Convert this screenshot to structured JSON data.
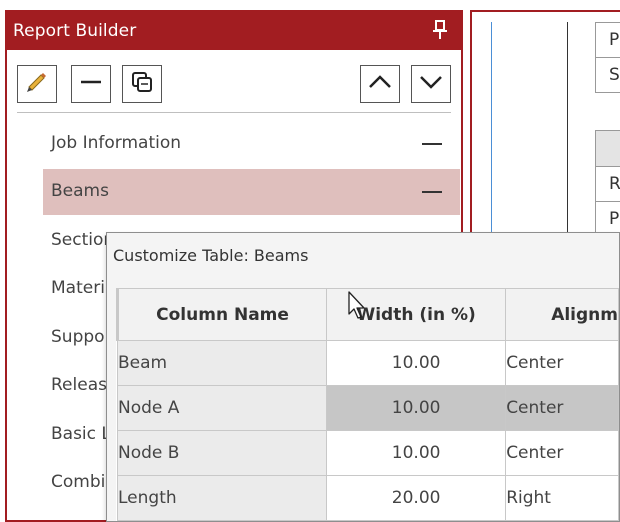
{
  "report_builder": {
    "title": "Report Builder",
    "toolbar": {
      "edit_icon": "pencil-icon",
      "collapse_icon": "minus-icon",
      "copy_icon": "copy-icon",
      "move_up_icon": "chevron-up-icon",
      "move_down_icon": "chevron-down-icon"
    },
    "items": [
      {
        "label": "Job Information"
      },
      {
        "label": "Beams"
      },
      {
        "label": "Section"
      },
      {
        "label": "Materi"
      },
      {
        "label": "Suppo"
      },
      {
        "label": "Releas"
      },
      {
        "label": "Basic L"
      },
      {
        "label": "Combi"
      }
    ],
    "selected_index": 1
  },
  "document_preview": {
    "cells": [
      "P",
      "S",
      "",
      "R",
      "P"
    ]
  },
  "customize_table": {
    "title": "Customize Table: Beams",
    "columns": [
      "Column Name",
      "Width (in %)",
      "Alignm"
    ],
    "rows": [
      {
        "name": "Beam",
        "width": "10.00",
        "align": "Center"
      },
      {
        "name": "Node A",
        "width": "10.00",
        "align": "Center"
      },
      {
        "name": "Node B",
        "width": "10.00",
        "align": "Center"
      },
      {
        "name": "Length",
        "width": "20.00",
        "align": "Right"
      }
    ],
    "highlighted_row": 1
  },
  "colors": {
    "accent": "#a21d21",
    "selected_item": "#dfbfbd",
    "highlight_cell": "#c6c6c6"
  }
}
